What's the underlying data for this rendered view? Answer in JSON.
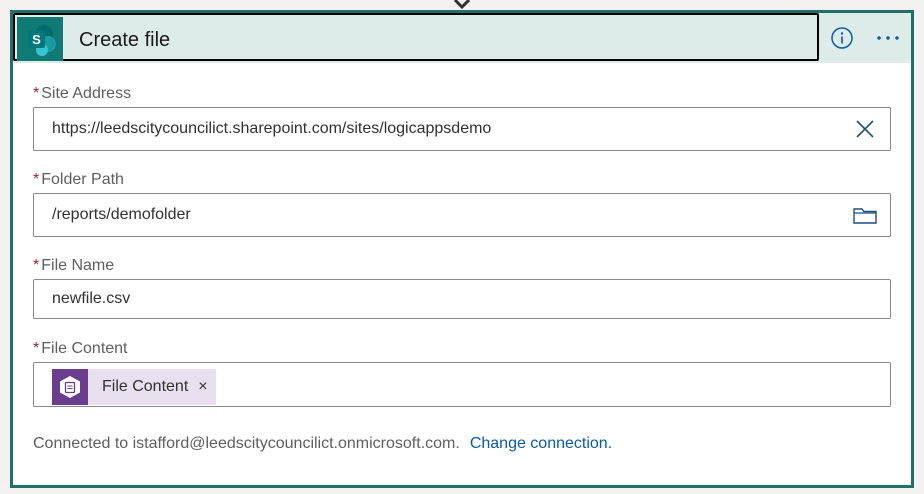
{
  "action": {
    "title": "Create file",
    "connector_icon": "sharepoint-icon",
    "info_icon": "info-icon",
    "more_icon": "more-options-icon"
  },
  "fields": {
    "site_address": {
      "label": "Site Address",
      "required_marker": "*",
      "value": "https://leedscitycouncilict.sharepoint.com/sites/logicappsdemo",
      "icon": "clear-icon"
    },
    "folder_path": {
      "label": "Folder Path",
      "required_marker": "*",
      "value": "/reports/demofolder",
      "icon": "folder-icon"
    },
    "file_name": {
      "label": "File Name",
      "required_marker": "*",
      "value": "newfile.csv"
    },
    "file_content": {
      "label": "File Content",
      "required_marker": "*",
      "token": {
        "label": "File Content",
        "remove": "×",
        "icon": "dynamic-content-icon"
      }
    }
  },
  "footer": {
    "connected_text": "Connected to istafford@leedscitycouncilict.onmicrosoft.com.",
    "change_link": "Change connection."
  },
  "colors": {
    "accent": "#1f6f6a",
    "header_bg": "#ddebe9",
    "required": "#a4262c",
    "link": "#0b5aa5",
    "token_bg": "#e8dfef",
    "token_icon_bg": "#6b3d8f"
  }
}
